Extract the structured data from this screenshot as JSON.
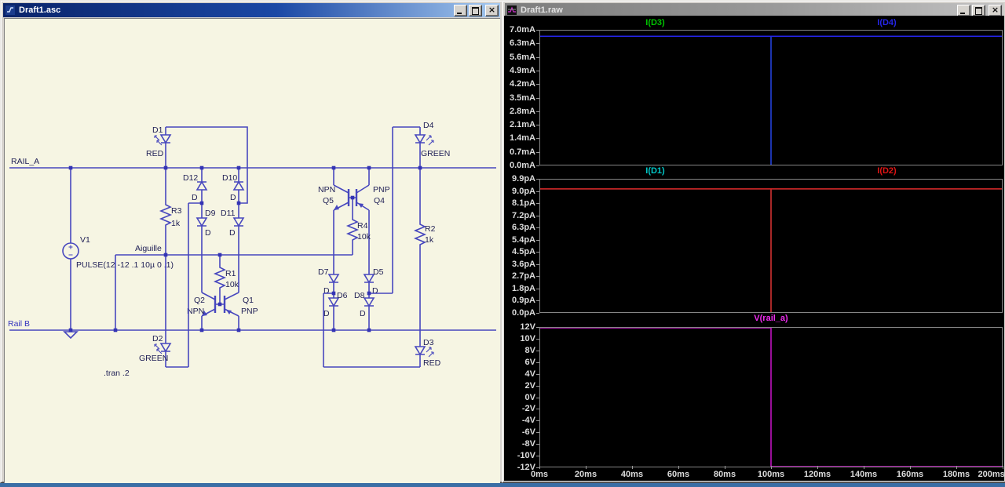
{
  "left_window": {
    "title": "Draft1.asc",
    "icon": "schematic-document-icon",
    "schematic": {
      "net_labels": {
        "rail_a": "RAIL_A",
        "rail_b": "Rail B",
        "aiguille": "Aiguille"
      },
      "directive": ".tran .2",
      "parts": {
        "v1": {
          "label": "V1",
          "value": "PULSE(12 -12 .1 10µ 0 .1)"
        },
        "r1": {
          "label": "R1",
          "value": "10k"
        },
        "r2": {
          "label": "R2",
          "value": "1k"
        },
        "r3": {
          "label": "R3",
          "value": "1k"
        },
        "r4": {
          "label": "R4",
          "value": "10k"
        },
        "d1": {
          "label": "D1",
          "value": "RED"
        },
        "d2": {
          "label": "D2",
          "value": "GREEN"
        },
        "d3": {
          "label": "D3",
          "value": "RED"
        },
        "d4": {
          "label": "D4",
          "value": "GREEN"
        },
        "d5": {
          "label": "D5",
          "value": "D"
        },
        "d6": {
          "label": "D6",
          "value": "D"
        },
        "d7": {
          "label": "D7",
          "value": "D"
        },
        "d8": {
          "label": "D8",
          "value": "D"
        },
        "d9": {
          "label": "D9",
          "value": "D"
        },
        "d10": {
          "label": "D10",
          "value": "D"
        },
        "d11": {
          "label": "D11",
          "value": "D"
        },
        "d12": {
          "label": "D12",
          "value": "D"
        },
        "q1": {
          "label": "Q1",
          "value": "PNP"
        },
        "q2": {
          "label": "Q2",
          "value": "NPN"
        },
        "q4": {
          "label": "Q4",
          "value": "PNP"
        },
        "q5": {
          "label": "Q5",
          "value": "NPN"
        }
      }
    }
  },
  "right_window": {
    "title": "Draft1.raw",
    "icon": "waveform-plot-icon"
  },
  "window_controls": {
    "close_glyph": "×"
  },
  "chart_data": {
    "type": "line",
    "grid": false,
    "background": "#000000",
    "xaxis": {
      "ticks": [
        "0ms",
        "20ms",
        "40ms",
        "60ms",
        "80ms",
        "100ms",
        "120ms",
        "140ms",
        "160ms",
        "180ms",
        "200ms"
      ],
      "xlim_ms": [
        0,
        200
      ]
    },
    "panels": [
      {
        "legend": [
          {
            "label": "I(D3)",
            "color": "#00C400"
          },
          {
            "label": "I(D4)",
            "color": "#2525E8"
          }
        ],
        "ylim": [
          0,
          7
        ],
        "yunit": "mA",
        "yticks": [
          "7.0mA",
          "6.3mA",
          "5.6mA",
          "4.9mA",
          "4.2mA",
          "3.5mA",
          "2.8mA",
          "2.1mA",
          "1.4mA",
          "0.7mA",
          "0.0mA"
        ],
        "series": [
          {
            "name": "I(D3)",
            "color": "#00C400",
            "points": [
              [
                0,
                6.7
              ],
              [
                100,
                6.7
              ],
              [
                100,
                0
              ],
              [
                100,
                6.7
              ],
              [
                200,
                6.7
              ]
            ]
          },
          {
            "name": "I(D4)",
            "color": "#2525E8",
            "points": [
              [
                0,
                6.7
              ],
              [
                100,
                6.7
              ],
              [
                100,
                0
              ],
              [
                100,
                6.7
              ],
              [
                200,
                6.7
              ]
            ]
          }
        ]
      },
      {
        "legend": [
          {
            "label": "I(D1)",
            "color": "#00C8C8"
          },
          {
            "label": "I(D2)",
            "color": "#E01414"
          }
        ],
        "ylim": [
          0,
          9.9
        ],
        "yunit": "pA",
        "yticks": [
          "9.9pA",
          "9.0pA",
          "8.1pA",
          "7.2pA",
          "6.3pA",
          "5.4pA",
          "4.5pA",
          "3.6pA",
          "2.7pA",
          "1.8pA",
          "0.9pA",
          "0.0pA"
        ],
        "series": [
          {
            "name": "I(D1)",
            "color": "#00C8C8",
            "points": [
              [
                0,
                9.2
              ],
              [
                100,
                9.2
              ],
              [
                100,
                0
              ],
              [
                100,
                9.2
              ],
              [
                200,
                9.2
              ]
            ]
          },
          {
            "name": "I(D2)",
            "color": "#E01414",
            "points": [
              [
                0,
                9.2
              ],
              [
                100,
                9.2
              ],
              [
                100,
                0
              ],
              [
                100,
                9.2
              ],
              [
                200,
                9.2
              ]
            ]
          }
        ]
      },
      {
        "legend": [
          {
            "label": "V(rail_a)",
            "color": "#F02CF0"
          }
        ],
        "ylim": [
          -12,
          12
        ],
        "yunit": "V",
        "yticks": [
          "12V",
          "10V",
          "8V",
          "6V",
          "4V",
          "2V",
          "0V",
          "-2V",
          "-4V",
          "-6V",
          "-8V",
          "-10V",
          "-12V"
        ],
        "series": [
          {
            "name": "V(rail_a)",
            "color": "#CC14CC",
            "points": [
              [
                0,
                12
              ],
              [
                100,
                12
              ],
              [
                100,
                -12
              ],
              [
                200,
                -12
              ]
            ]
          }
        ]
      }
    ]
  }
}
